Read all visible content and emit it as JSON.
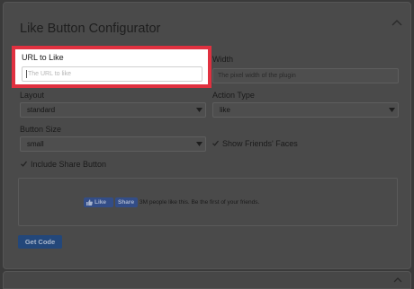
{
  "panel": {
    "title": "Like Button Configurator"
  },
  "url_field": {
    "label": "URL to Like",
    "placeholder": "The URL to like"
  },
  "width_field": {
    "label": "Width",
    "placeholder": "The pixel width of the plugin"
  },
  "layout_field": {
    "label": "Layout",
    "value": "standard"
  },
  "action_type_field": {
    "label": "Action Type",
    "value": "like"
  },
  "button_size_field": {
    "label": "Button Size",
    "value": "small"
  },
  "show_faces": {
    "label": "Show Friends' Faces",
    "checked": true
  },
  "include_share": {
    "label": "Include Share Button",
    "checked": true
  },
  "preview": {
    "like_label": "Like",
    "share_label": "Share",
    "count_text": "3M people like this. Be the first of your friends."
  },
  "actions": {
    "get_code_label": "Get Code"
  },
  "colors": {
    "highlight_border": "#e03140",
    "facebook_blue": "#334d87",
    "get_code_blue": "#23477a"
  }
}
